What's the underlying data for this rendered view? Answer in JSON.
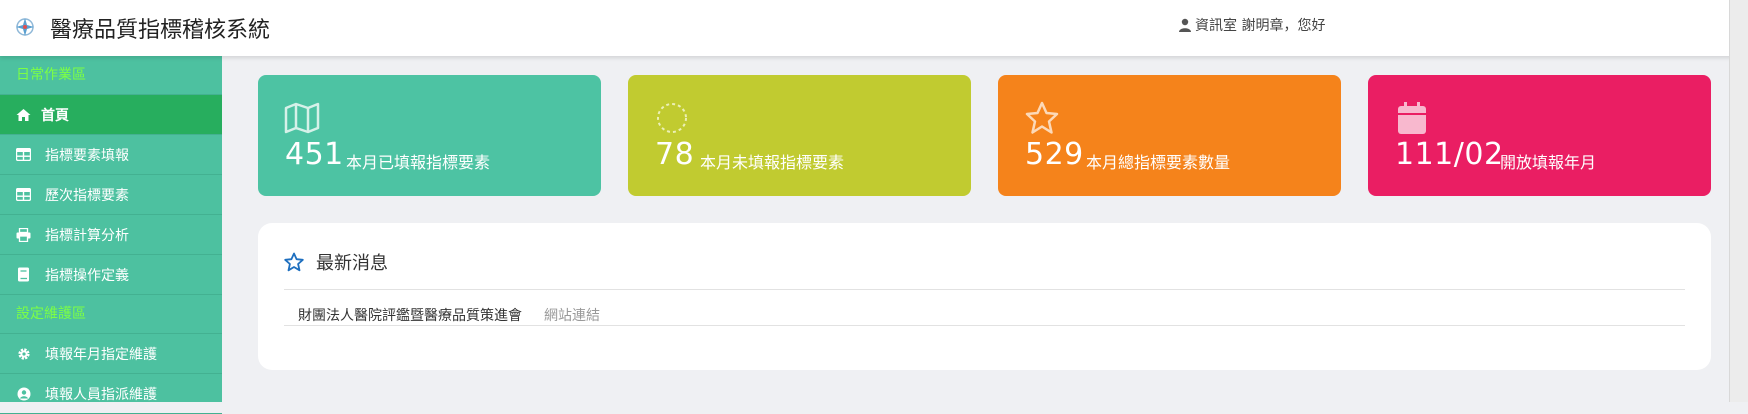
{
  "header": {
    "app_title": "醫療品質指標稽核系統",
    "user_greeting": "資訊室 謝明章，您好"
  },
  "sidebar": {
    "section1_title": "日常作業區",
    "items1": [
      {
        "label": "首頁",
        "icon": "home-icon"
      },
      {
        "label": "指標要素填報",
        "icon": "table-icon"
      },
      {
        "label": "歷次指標要素",
        "icon": "table-icon"
      },
      {
        "label": "指標計算分析",
        "icon": "print-icon"
      },
      {
        "label": "指標操作定義",
        "icon": "book-icon"
      }
    ],
    "section2_title": "設定維護區",
    "items2": [
      {
        "label": "填報年月指定維護",
        "icon": "gear-icon"
      },
      {
        "label": "填報人員指派維護",
        "icon": "user-circle-icon"
      }
    ]
  },
  "cards": [
    {
      "value": "451",
      "label": "本月已填報指標要素",
      "icon": "map-icon",
      "color": "#4dc3a3"
    },
    {
      "value": "78",
      "label": "本月未填報指標要素",
      "icon": "spinner-icon",
      "color": "#c1cb30"
    },
    {
      "value": "529",
      "label": "本月總指標要素數量",
      "icon": "star-icon",
      "color": "#f5831b"
    },
    {
      "value": "111/02",
      "label": "開放填報年月",
      "icon": "calendar-icon",
      "color": "#ea1e63"
    }
  ],
  "news": {
    "title": "最新消息",
    "item_text": "財團法人醫院評鑑暨醫療品質策進會",
    "link_text": "網站連結"
  },
  "colors": {
    "sidebar_bg": "#4dc1a0",
    "sidebar_active": "#27ae5e",
    "section_title": "#7cff45",
    "news_icon": "#1e6fbf"
  }
}
